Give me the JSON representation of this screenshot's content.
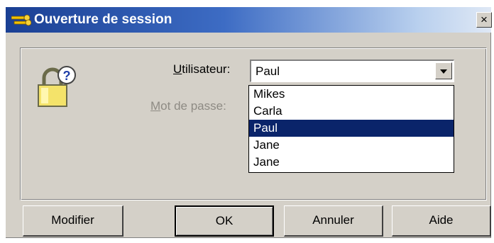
{
  "window": {
    "title": "Ouverture de session",
    "close_label": "×"
  },
  "form": {
    "user_label": "Utilisateur:",
    "password_label": "Mot de passe:",
    "selected_user": "Paul"
  },
  "dropdown": {
    "options": [
      "Mikes",
      "Carla",
      "Paul",
      "Jane",
      "Jane"
    ],
    "selected_index": 2
  },
  "buttons": {
    "modify": "Modifier",
    "ok": "OK",
    "cancel": "Annuler",
    "help": "Aide"
  },
  "colors": {
    "title_start": "#1a3f93",
    "title_end": "#dfe8f5",
    "selection": "#0a246a",
    "face": "#d4d0c8"
  }
}
